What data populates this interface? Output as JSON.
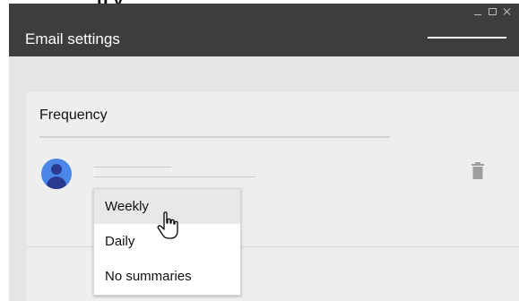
{
  "window": {
    "title": "Email settings"
  },
  "card": {
    "section_title": "Frequency"
  },
  "dropdown": {
    "options": [
      "Weekly",
      "Daily",
      "No summaries"
    ],
    "hovered": "Weekly"
  },
  "icons": {
    "avatar": "user-avatar-icon",
    "delete": "trash-icon",
    "cursor": "hand-pointer-cursor"
  },
  "colors": {
    "titlebar": "#3d3d3d",
    "window_bg": "#e5e5e5",
    "card_bg": "#eeeeee",
    "avatar": "#4a86e8",
    "menu_hover": "#e8e8e8"
  }
}
